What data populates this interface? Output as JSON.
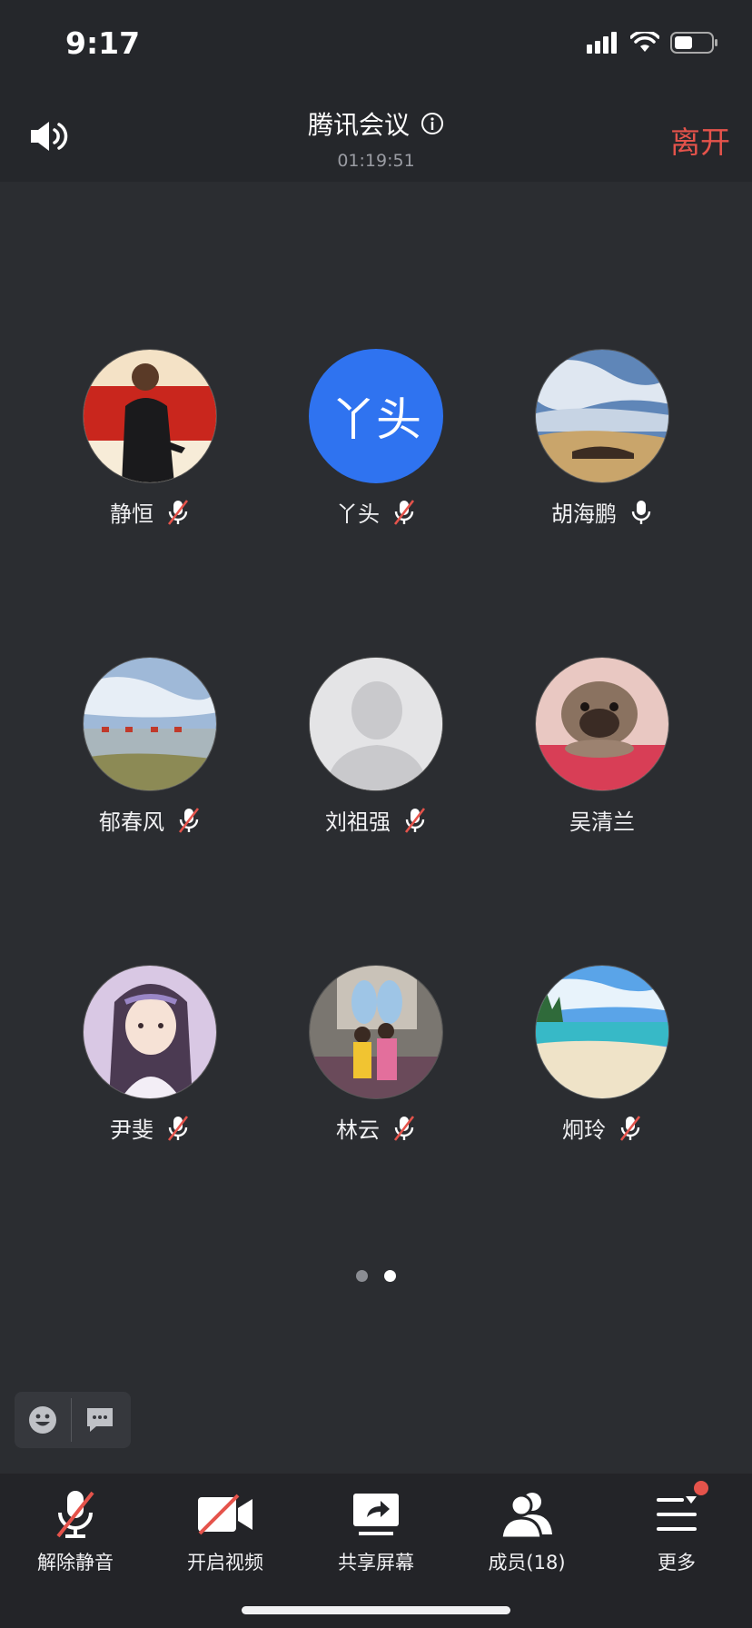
{
  "status_bar": {
    "time": "9:17"
  },
  "header": {
    "title": "腾讯会议",
    "timer": "01:19:51",
    "leave_label": "离开"
  },
  "participants": [
    {
      "name": "静恒",
      "mic": "muted",
      "avatar": "photo-man"
    },
    {
      "name": "丫头",
      "mic": "muted",
      "avatar": "text",
      "avatar_text": "丫头",
      "avatar_color": "#2f73f0"
    },
    {
      "name": "胡海鹏",
      "mic": "on",
      "avatar": "photo-desert"
    },
    {
      "name": "郁春风",
      "mic": "muted",
      "avatar": "photo-lake"
    },
    {
      "name": "刘祖强",
      "mic": "muted",
      "avatar": "default"
    },
    {
      "name": "吴清兰",
      "mic": "none",
      "avatar": "photo-dog"
    },
    {
      "name": "尹斐",
      "mic": "muted",
      "avatar": "photo-cartoon-girl"
    },
    {
      "name": "林云",
      "mic": "muted",
      "avatar": "photo-people"
    },
    {
      "name": "炯玲",
      "mic": "muted",
      "avatar": "photo-beach"
    }
  ],
  "pagination": {
    "total": 2,
    "current": 2
  },
  "toolbar": {
    "unmute_label": "解除静音",
    "video_label": "开启视频",
    "share_label": "共享屏幕",
    "members_label": "成员(18)",
    "more_label": "更多"
  },
  "colors": {
    "accent_red": "#e5534b",
    "avatar_blue": "#2f73f0",
    "background": "#2b2d31"
  }
}
